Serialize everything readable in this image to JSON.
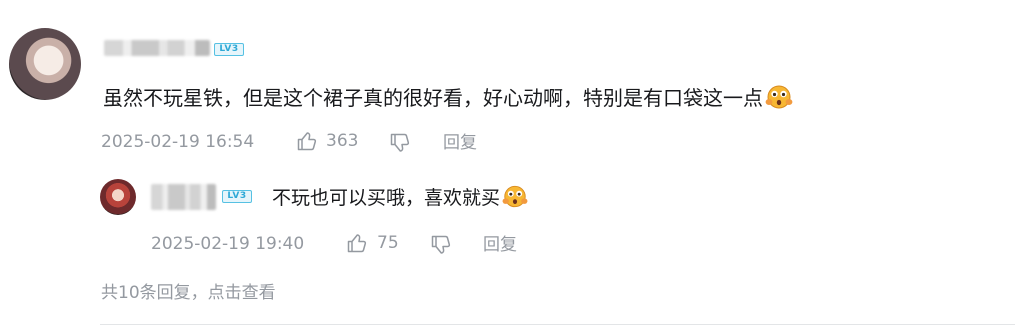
{
  "comment": {
    "level_badge": "LV3",
    "text": "虽然不玩星铁，但是这个裙子真的很好看，好心动啊，特别是有口袋这一点",
    "emoji": "flushed-face-emoji",
    "date": "2025-02-19 16:54",
    "likes": "363",
    "reply_label": "回复"
  },
  "reply": {
    "level_badge": "LV3",
    "text": "不玩也可以买哦，喜欢就买",
    "emoji": "flushed-face-emoji",
    "date": "2025-02-19 19:40",
    "likes": "75",
    "reply_label": "回复"
  },
  "more_replies": "共10条回复，点击查看",
  "colors": {
    "text": "#18191c",
    "meta": "#9499a0",
    "badge": "#56c1e3",
    "divider": "#e3e5e7"
  },
  "icons": [
    "thumbs-up-icon",
    "thumbs-down-icon"
  ]
}
